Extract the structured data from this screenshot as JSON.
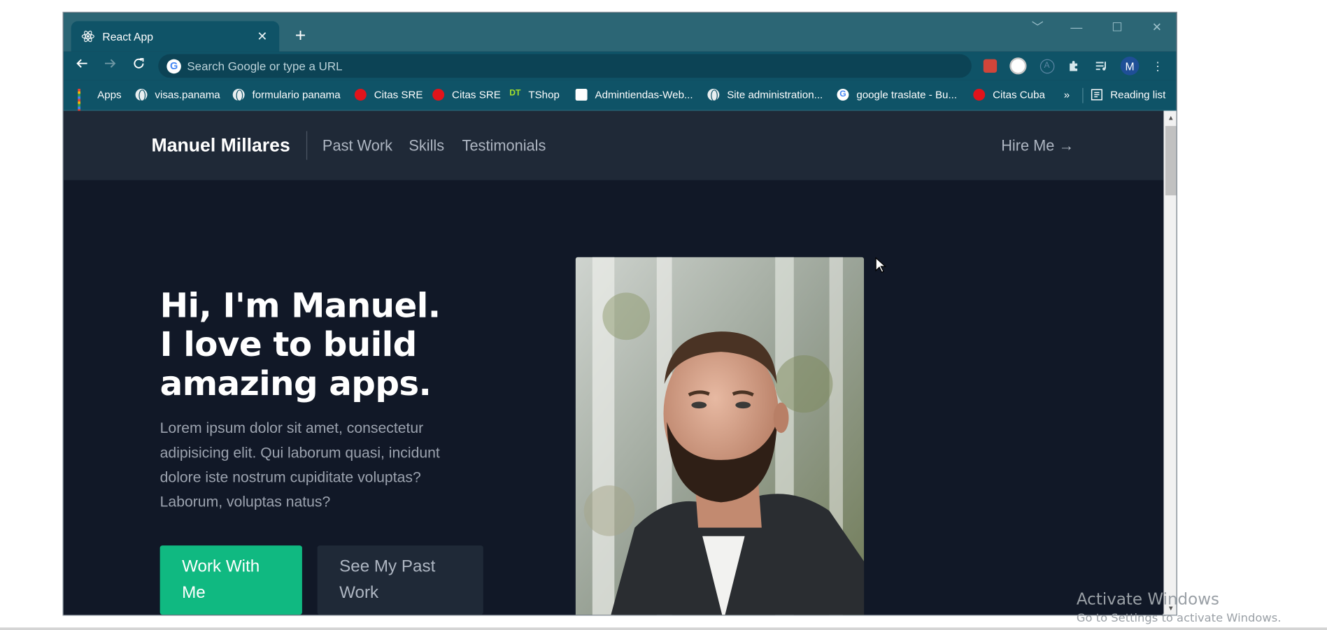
{
  "browser": {
    "tab_title": "React App",
    "omnibox_placeholder": "Search Google or type a URL",
    "profile_initial": "M",
    "bookmarks": [
      {
        "label": "Apps",
        "icon": "apps-grid-icon"
      },
      {
        "label": "visas.panama",
        "icon": "globe-icon"
      },
      {
        "label": "formulario panama",
        "icon": "globe-icon"
      },
      {
        "label": "Citas SRE",
        "icon": "red-circle-icon"
      },
      {
        "label": "Citas SRE",
        "icon": "red-circle-icon"
      },
      {
        "label": "TShop",
        "icon": "dt-icon"
      },
      {
        "label": "Admintiendas-Web...",
        "icon": "admin-icon"
      },
      {
        "label": "Site administration...",
        "icon": "globe-icon"
      },
      {
        "label": "google traslate - Bu...",
        "icon": "google-icon"
      },
      {
        "label": "Citas Cuba",
        "icon": "red-circle-icon"
      }
    ],
    "overflow_label": "»",
    "reading_list_label": "Reading list"
  },
  "site": {
    "brand": "Manuel Millares",
    "nav": [
      "Past Work",
      "Skills",
      "Testimonials"
    ],
    "hire_label": "Hire Me",
    "hire_arrow": "→",
    "hero_lines": [
      "Hi, I'm Manuel.",
      "I love to build",
      "amazing apps."
    ],
    "hero_text": "Lorem ipsum dolor sit amet, consectetur adipisicing elit. Qui laborum quasi, incidunt dolore iste nostrum cupiditate voluptas? Laborum, voluptas natus?",
    "primary_button": "Work With Me",
    "secondary_button": "See My Past Work"
  },
  "os": {
    "watermark_title": "Activate Windows",
    "watermark_subtitle": "Go to Settings to activate Windows."
  },
  "colors": {
    "tab_strip": "#2c6675",
    "toolbar": "#0f5367",
    "page_bg": "#111827",
    "header_bg": "#1f2937",
    "accent": "#10b981"
  }
}
